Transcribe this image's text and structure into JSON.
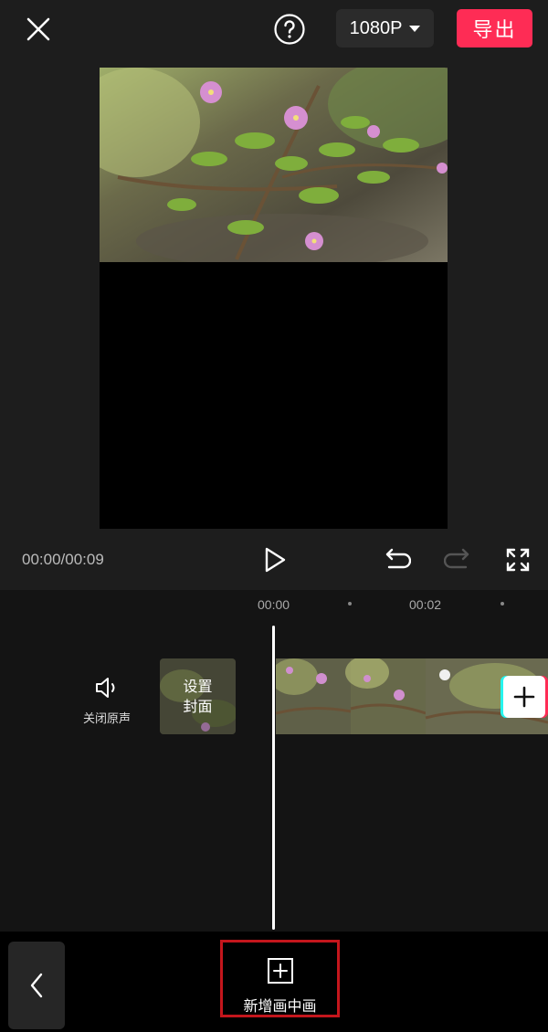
{
  "header": {
    "resolution": "1080P",
    "export_label": "导出"
  },
  "playback": {
    "timecode": "00:00/00:09"
  },
  "timeline": {
    "ruler_labels": [
      "00:00",
      "00:02"
    ],
    "mute_label": "关闭原声",
    "cover_label_line1": "设置",
    "cover_label_line2": "封面"
  },
  "toolbar": {
    "add_pip_label": "新增画中画"
  },
  "colors": {
    "accent": "#fe2c55",
    "highlight_box": "#c4161c"
  },
  "icons": [
    "close-icon",
    "help-icon",
    "caret-down-icon",
    "play-icon",
    "undo-icon",
    "redo-icon",
    "fullscreen-icon",
    "speaker-icon",
    "plus-icon",
    "chevron-left-icon",
    "add-box-icon"
  ]
}
